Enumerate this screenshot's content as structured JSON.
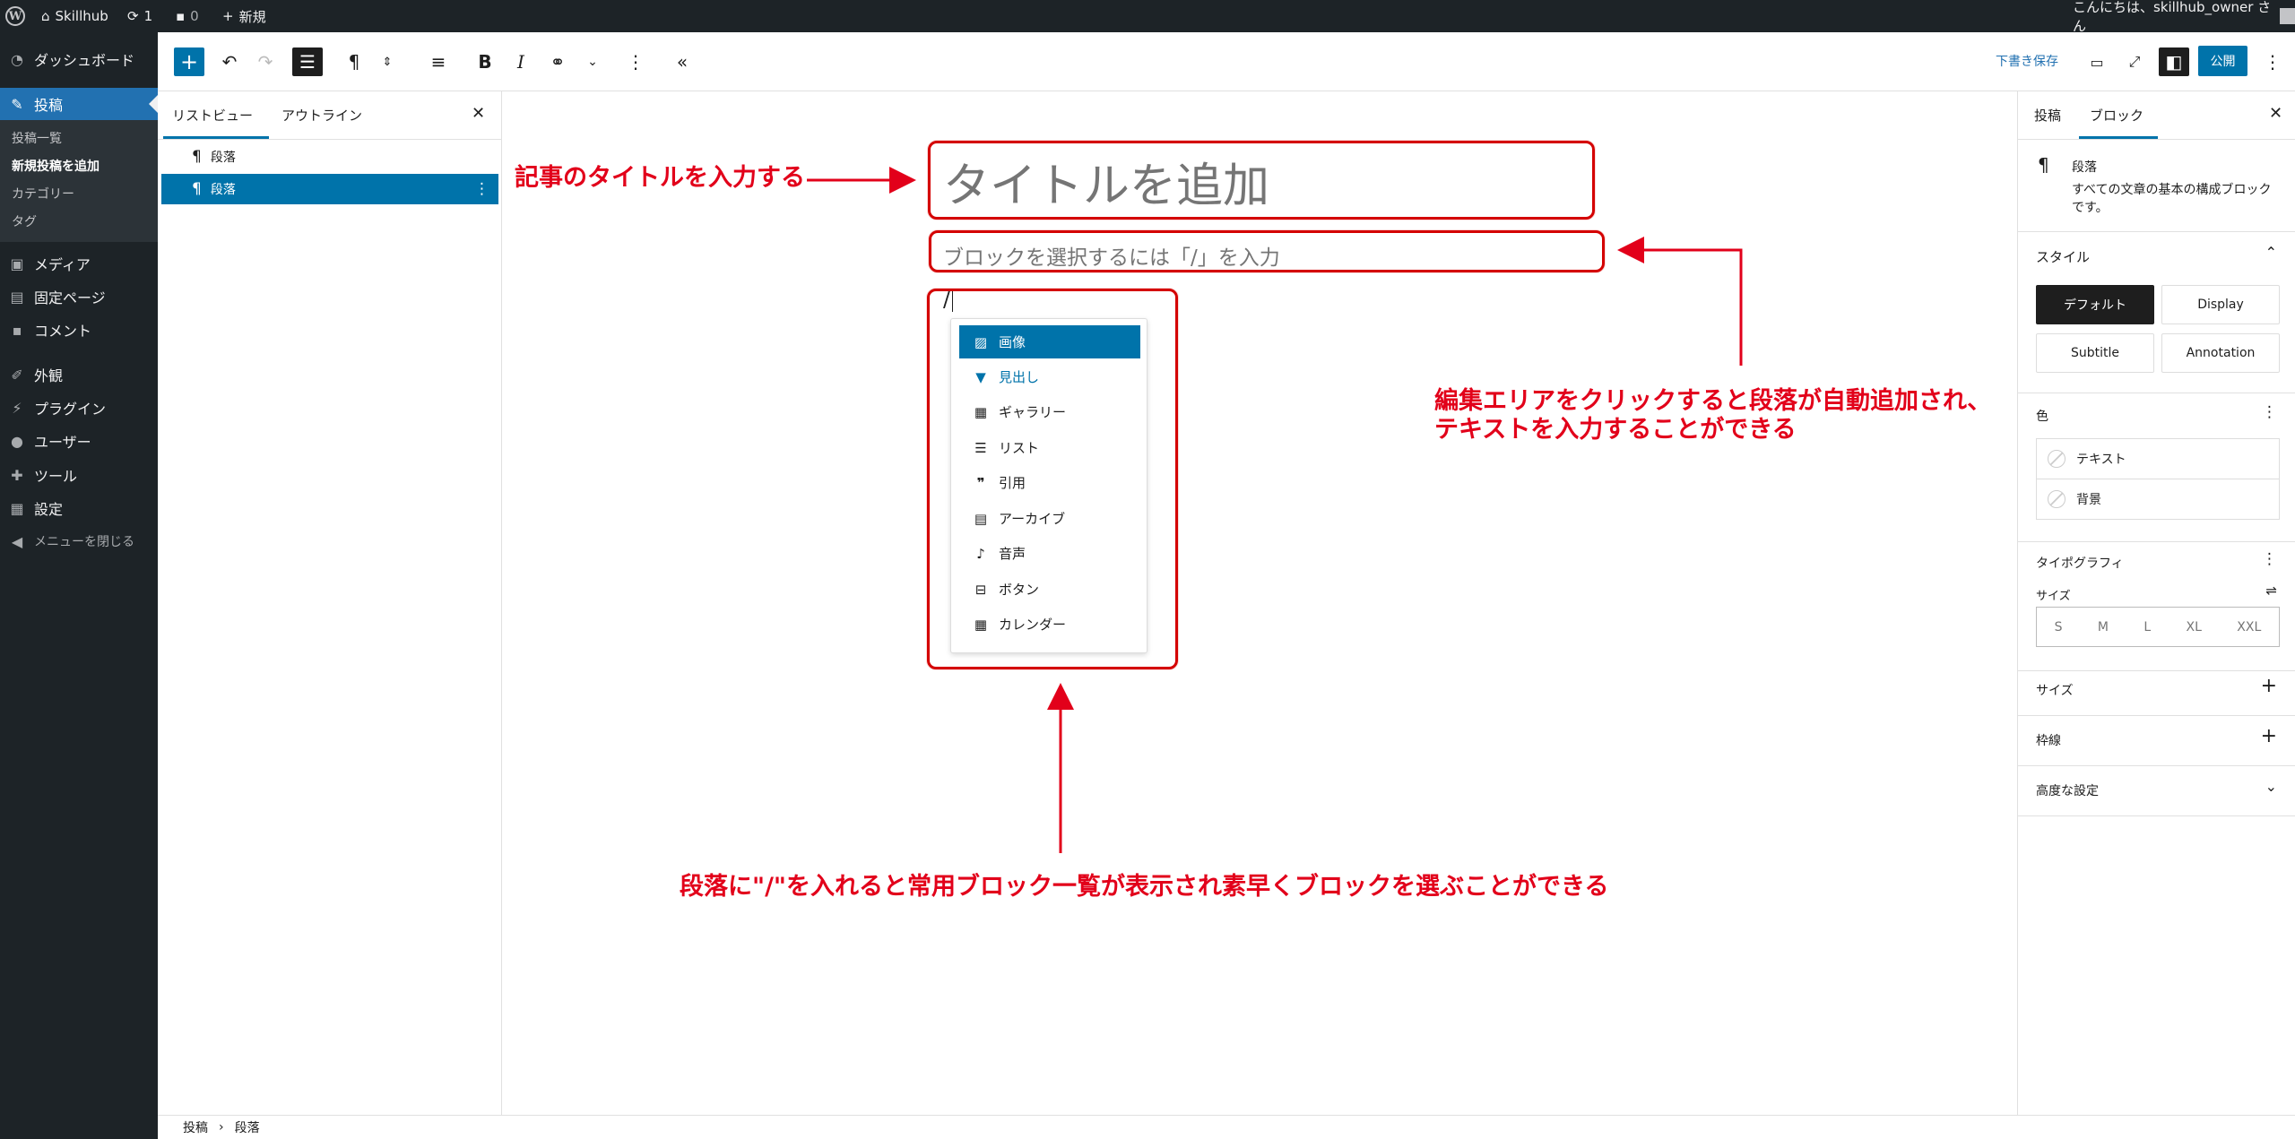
{
  "admin_bar": {
    "site_name": "Skillhub",
    "updates_count": "1",
    "comments_count": "0",
    "new_label": "新規",
    "greeting": "こんにちは、skillhub_owner さん"
  },
  "admin_menu": {
    "dashboard": "ダッシュボード",
    "posts": "投稿",
    "submenu": [
      "投稿一覧",
      "新規投稿を追加",
      "カテゴリー",
      "タグ"
    ],
    "media": "メディア",
    "pages": "固定ページ",
    "comments": "コメント",
    "appearance": "外観",
    "plugins": "プラグイン",
    "users": "ユーザー",
    "tools": "ツール",
    "settings": "設定",
    "collapse": "メニューを閉じる"
  },
  "toolbar": {
    "save_draft": "下書き保存",
    "publish": "公開"
  },
  "list_view": {
    "tabs": [
      "リストビュー",
      "アウトライン"
    ],
    "items": [
      "段落",
      "段落"
    ]
  },
  "editor": {
    "title_placeholder": "タイトルを追加",
    "paragraph_placeholder": "ブロックを選択するには「/」を入力",
    "slash_text": "/"
  },
  "slash_menu": {
    "items": [
      "画像",
      "見出し",
      "ギャラリー",
      "リスト",
      "引用",
      "アーカイブ",
      "音声",
      "ボタン",
      "カレンダー"
    ]
  },
  "annotations": {
    "title_note": "記事のタイトルを入力する",
    "paragraph_note_line1": "編集エリアをクリックすると段落が自動追加され、",
    "paragraph_note_line2": "テキストを入力することができる",
    "slash_note": "段落に\"/\"を入れると常用ブロック一覧が表示され素早くブロックを選ぶことができる"
  },
  "sidebar": {
    "tabs": [
      "投稿",
      "ブロック"
    ],
    "block_name": "段落",
    "block_desc": "すべての文章の基本の構成ブロックです。",
    "style_heading": "スタイル",
    "styles": [
      "デフォルト",
      "Display",
      "Subtitle",
      "Annotation"
    ],
    "color_heading": "色",
    "colors": [
      "テキスト",
      "背景"
    ],
    "typography_heading": "タイポグラフィ",
    "size_label": "サイズ",
    "sizes": [
      "S",
      "M",
      "L",
      "XL",
      "XXL"
    ],
    "dimensions_heading": "サイズ",
    "border_heading": "枠線",
    "advanced_heading": "高度な設定"
  },
  "breadcrumb": [
    "投稿",
    "段落"
  ],
  "colors": {
    "accent": "#0073aa",
    "annotation_red": "#e2001a",
    "admin_dark": "#1d2327"
  }
}
